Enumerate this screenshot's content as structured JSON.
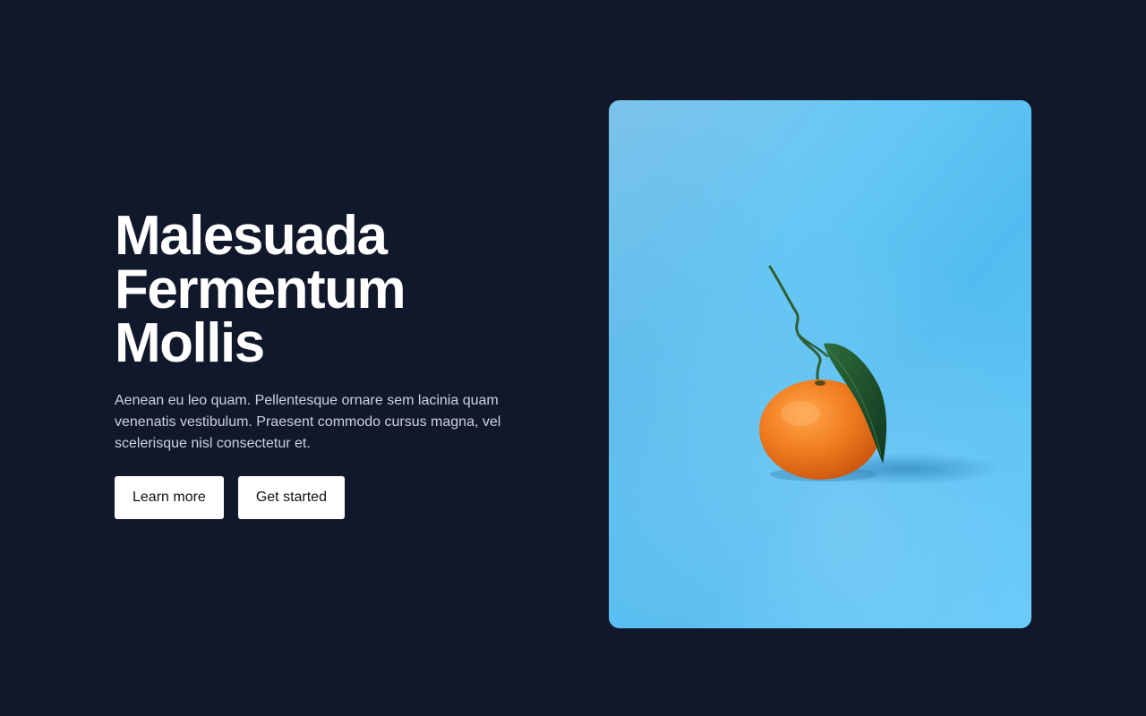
{
  "hero": {
    "title_lines": [
      "Malesuada",
      "Fermentum",
      "Mollis"
    ],
    "description": "Aenean eu leo quam. Pellentesque ornare sem lacinia quam venenatis vestibulum. Praesent commodo cursus magna, vel scelerisque nisl consectetur et.",
    "buttons": {
      "learn_more": "Learn more",
      "get_started": "Get started"
    }
  },
  "image": {
    "subject": "mandarin-orange-with-leaf",
    "background_color": "#63c6f4",
    "fruit_color": "#f07a1e"
  },
  "colors": {
    "page_background": "#11182b",
    "title": "#ffffff",
    "description": "#cbd2de",
    "button_background": "#ffffff",
    "button_text": "#111111"
  }
}
